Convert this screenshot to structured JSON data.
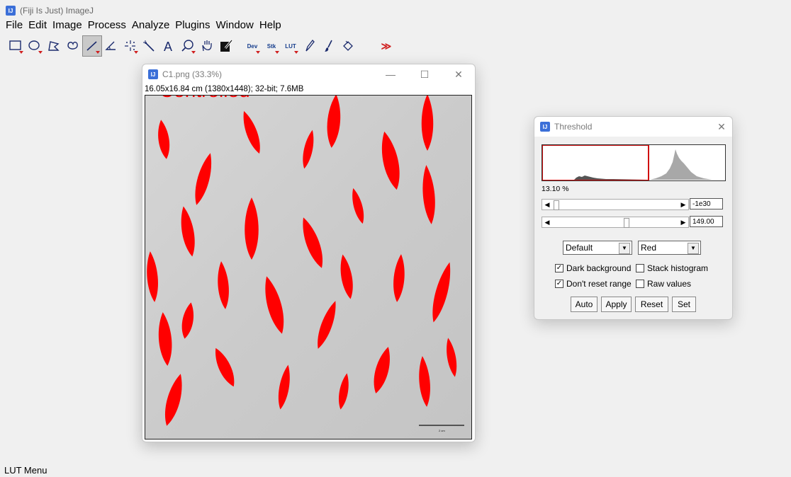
{
  "app": {
    "title": "(Fiji Is Just) ImageJ",
    "icon_text": "IJ"
  },
  "menu": [
    "File",
    "Edit",
    "Image",
    "Process",
    "Analyze",
    "Plugins",
    "Window",
    "Help"
  ],
  "toolbar": {
    "dev_label": "Dev",
    "stk_label": "Stk",
    "lut_label": "LUT",
    "more_label": "≫"
  },
  "status_text": "LUT Menu",
  "image_window": {
    "title": "C1.png (33.3%)",
    "info": "16.05x16.84 cm (1380x1448); 32-bit; 7.6MB",
    "minimize": "—",
    "maximize": "☐",
    "close": "✕",
    "overlay_text": "Controlled",
    "scale_bar_label": "2 cm"
  },
  "threshold": {
    "title": "Threshold",
    "close": "✕",
    "percent": "13.10 %",
    "min_value": "-1e30",
    "max_value": "149.00",
    "method": "Default",
    "display": "Red",
    "dark_background": {
      "label": "Dark background",
      "checked": true
    },
    "stack_histogram": {
      "label": "Stack histogram",
      "checked": false
    },
    "dont_reset_range": {
      "label": "Don't reset range",
      "checked": true
    },
    "raw_values": {
      "label": "Raw values",
      "checked": false
    },
    "buttons": {
      "auto": "Auto",
      "apply": "Apply",
      "reset": "Reset",
      "set": "Set"
    },
    "min_slider_fraction": 0.0,
    "max_slider_fraction": 0.58
  },
  "colors": {
    "threshold_red": "#ff0000",
    "fiji_blue": "#3b6fd8"
  }
}
